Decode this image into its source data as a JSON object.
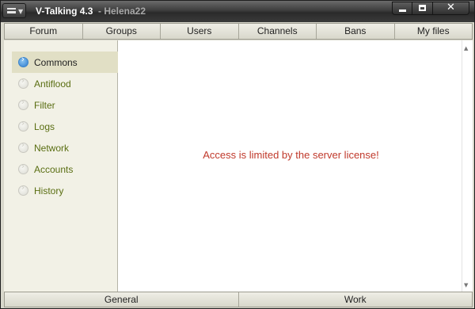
{
  "window": {
    "app_title": "V-Talking 4.3",
    "user_title": "- Helena22",
    "controls": {
      "minimize": "minimize-icon",
      "maximize": "maximize-icon",
      "close": "close-icon"
    }
  },
  "tabs": [
    {
      "label": "Forum"
    },
    {
      "label": "Groups"
    },
    {
      "label": "Users"
    },
    {
      "label": "Channels"
    },
    {
      "label": "Bans"
    },
    {
      "label": "My files"
    }
  ],
  "sidebar": {
    "active": "Commons",
    "items": [
      {
        "label": "Commons",
        "icon": "arrow-circle-icon"
      },
      {
        "label": "Antiflood",
        "icon": "arrow-circle-icon"
      },
      {
        "label": "Filter",
        "icon": "arrow-circle-icon"
      },
      {
        "label": "Logs",
        "icon": "arrow-circle-icon"
      },
      {
        "label": "Network",
        "icon": "arrow-circle-icon"
      },
      {
        "label": "Accounts",
        "icon": "arrow-circle-icon"
      },
      {
        "label": "History",
        "icon": "arrow-circle-icon"
      }
    ]
  },
  "main": {
    "message": "Access is limited by the server license!"
  },
  "bottom_tabs": [
    {
      "label": "General"
    },
    {
      "label": "Work"
    }
  ],
  "colors": {
    "message": "#c0392b",
    "nav_text": "#5a6e12",
    "active_icon": "#2f7bcd"
  }
}
